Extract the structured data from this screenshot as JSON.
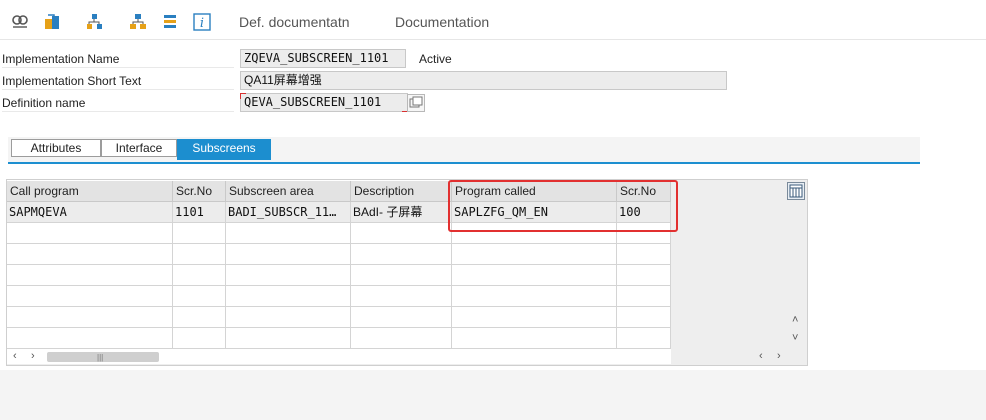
{
  "toolbar": {
    "def_documentation": "Def. documentatn",
    "documentation": "Documentation"
  },
  "fields": {
    "impl_name": {
      "label": "Implementation Name",
      "value": "ZQEVA_SUBSCREEN_1101",
      "status": "Active"
    },
    "impl_short_text": {
      "label": "Implementation Short Text",
      "value": "QA11屏幕增强"
    },
    "definition_name": {
      "label": "Definition name",
      "value": "QEVA_SUBSCREEN_1101"
    }
  },
  "tabs": [
    {
      "label": "Attributes",
      "active": false
    },
    {
      "label": "Interface",
      "active": false
    },
    {
      "label": "Subscreens",
      "active": true
    }
  ],
  "table": {
    "columns": [
      "Call program",
      "Scr.No",
      "Subscreen area",
      "Description",
      "Program called",
      "Scr.No"
    ],
    "rows": [
      [
        "SAPMQEVA",
        "1101",
        "BADI_SUBSCR_11…",
        "BAdI- 子屏幕",
        "SAPLZFG_QM_EN",
        "100"
      ]
    ]
  },
  "colors": {
    "accent": "#1c8ecf",
    "highlight": "#e23030"
  }
}
